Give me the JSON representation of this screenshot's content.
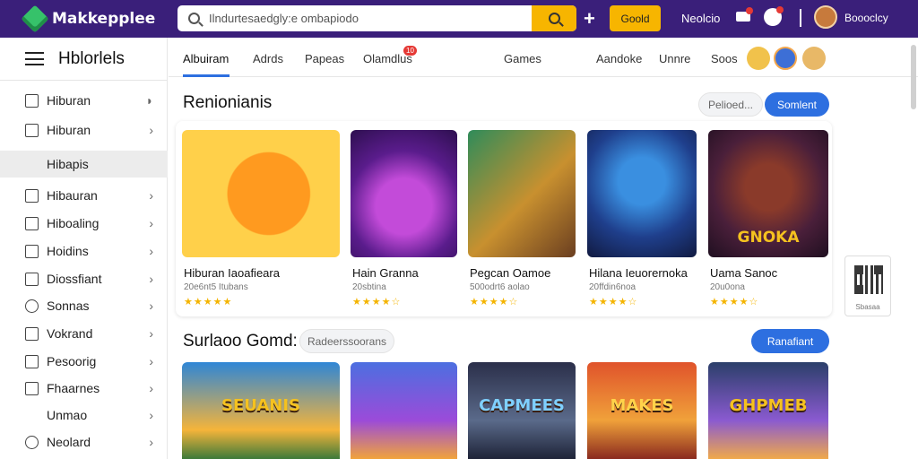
{
  "app": {
    "name": "Makkepplee",
    "brand_color": "#3a1f7a",
    "accent": "#f7b500"
  },
  "header": {
    "search_placeholder": "Ilndurtesaedgly:e ombapiodo",
    "create_label": "Goold",
    "link_label": "Neolcio",
    "user_name": "Boooclcy"
  },
  "sidebar": {
    "title": "Hblorlels",
    "items": [
      {
        "label": "Hiburan",
        "icon": "shield-icon",
        "chevron": "◗"
      },
      {
        "label": "Hiburan",
        "icon": "box-icon",
        "chevron": "›"
      },
      {
        "label": "Hibapis",
        "icon": "none",
        "chevron": ""
      },
      {
        "label": "Hibauran",
        "icon": "box-icon",
        "chevron": "›"
      },
      {
        "label": "Hiboaling",
        "icon": "box-icon",
        "chevron": "›"
      },
      {
        "label": "Hoidins",
        "icon": "home-icon",
        "chevron": "›"
      },
      {
        "label": "Diossfiant",
        "icon": "box-icon",
        "chevron": "›"
      },
      {
        "label": "Sonnas",
        "icon": "circle-icon",
        "chevron": "›"
      },
      {
        "label": "Vokrand",
        "icon": "box-icon",
        "chevron": "›"
      },
      {
        "label": "Pesoorig",
        "icon": "box-icon",
        "chevron": "›"
      },
      {
        "label": "Fhaarnes",
        "icon": "box-icon",
        "chevron": "›"
      },
      {
        "label": "Unmao",
        "icon": "none",
        "chevron": "›"
      },
      {
        "label": "Neolard",
        "icon": "circle-icon",
        "chevron": "›"
      }
    ]
  },
  "tabs": [
    {
      "label": "Albuiram"
    },
    {
      "label": "Adrds"
    },
    {
      "label": "Papeas"
    },
    {
      "label": "Olamdlus",
      "badge": "10"
    },
    {
      "label": "Games"
    },
    {
      "label": "Aandoke"
    },
    {
      "label": "Unnre"
    },
    {
      "label": "Soos"
    }
  ],
  "section1": {
    "title": "Renionianis",
    "filter_label": "Pelioed...",
    "action_label": "Somlent",
    "cards": [
      {
        "title": "Hiburan Iaoafieara",
        "meta": "20e6nt5 Itubans",
        "rating": "★★★★★",
        "thumb_text": ""
      },
      {
        "title": "Hain Granna",
        "meta": "20sbtina",
        "rating": "★★★★☆",
        "thumb_text": ""
      },
      {
        "title": "Pegcan Oamoe",
        "meta": "500odrt6 aolao",
        "rating": "★★★★☆",
        "thumb_text": ""
      },
      {
        "title": "Hilana Ieuorernoka",
        "meta": "20ffdin6noa",
        "rating": "★★★★☆",
        "thumb_text": ""
      },
      {
        "title": "Uama Sanoc",
        "meta": "20u0ona",
        "rating": "★★★★☆",
        "thumb_text": "GNOKA"
      }
    ]
  },
  "section2": {
    "title": "Surlaoo Gomd:",
    "filter_label": "Radeerssoorans",
    "action_label": "Ranafiant",
    "cards": [
      {
        "thumb_text": "SEUANIS"
      },
      {
        "thumb_text": ""
      },
      {
        "thumb_text": "CAPMEES"
      },
      {
        "thumb_text": "MAKES"
      },
      {
        "thumb_text": "GHPMEB"
      }
    ]
  },
  "qr": {
    "label": "Sbasaa"
  }
}
